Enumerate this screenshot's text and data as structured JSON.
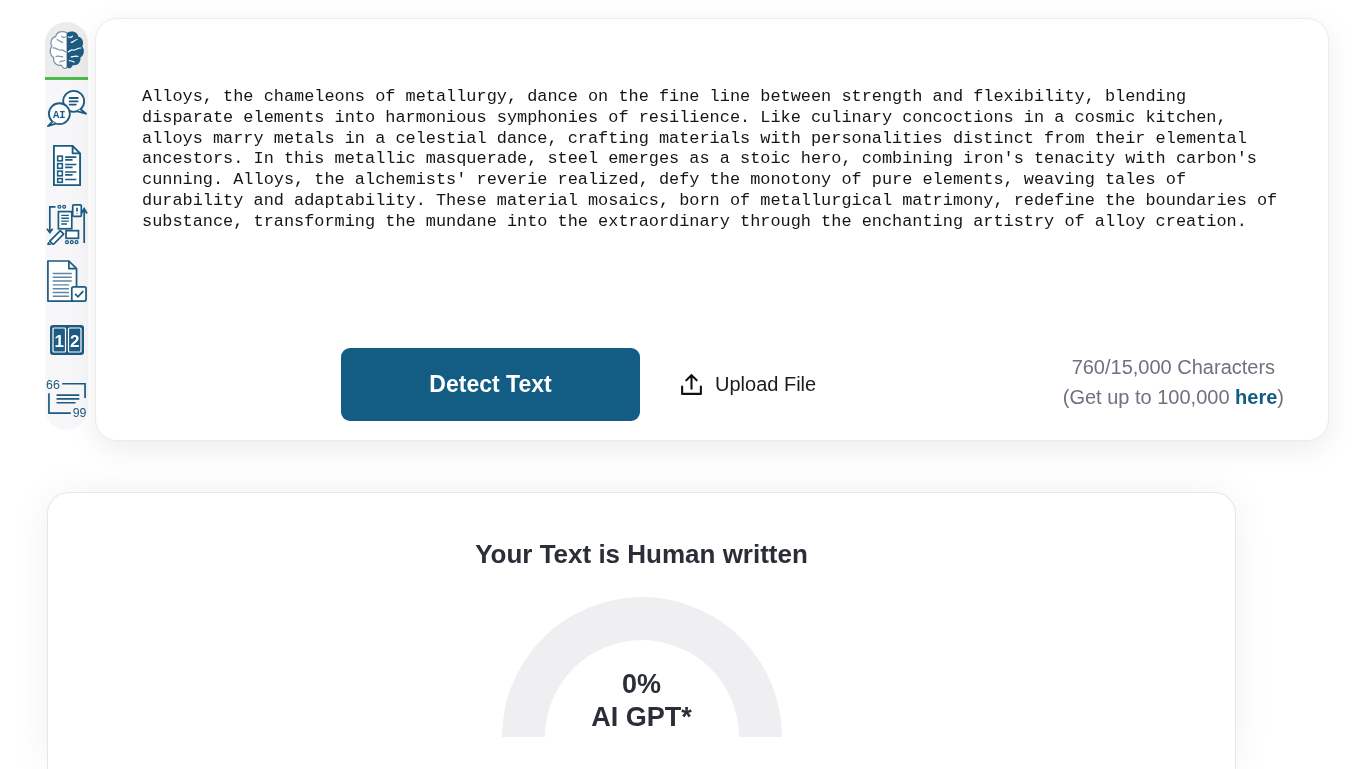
{
  "sidebar": {
    "items": [
      {
        "selected": true
      },
      {
        "selected": false,
        "icon_texts": [
          "AI"
        ]
      },
      {
        "selected": false
      },
      {
        "selected": false
      },
      {
        "selected": false
      },
      {
        "selected": false,
        "icon_texts": [
          "1",
          "2"
        ]
      },
      {
        "selected": false,
        "icon_texts": [
          "66",
          "99"
        ]
      }
    ]
  },
  "editor": {
    "text": "Alloys, the chameleons of metallurgy, dance on the fine line between strength and flexibility, blending disparate elements into harmonious symphonies of resilience. Like culinary concoctions in a cosmic kitchen, alloys marry metals in a celestial dance, crafting materials with personalities distinct from their elemental ancestors. In this metallic masquerade, steel emerges as a stoic hero, combining iron's tenacity with carbon's cunning. Alloys, the alchemists' reverie realized, defy the monotony of pure elements, weaving tales of durability and adaptability. These material mosaics, born of metallurgical matrimony, redefine the boundaries of substance, transforming the mundane into the extraordinary through the enchanting artistry of alloy creation.",
    "detect_button": "Detect Text",
    "upload_button": "Upload File",
    "character_count": "760/15,000 Characters",
    "upgrade_note": {
      "prefix": "(Get up to 100,000",
      "link": "here",
      "suffix": ")"
    }
  },
  "result": {
    "title": "Your Text is Human written",
    "gauge": {
      "value": "0%",
      "label": "AI GPT*"
    }
  }
}
